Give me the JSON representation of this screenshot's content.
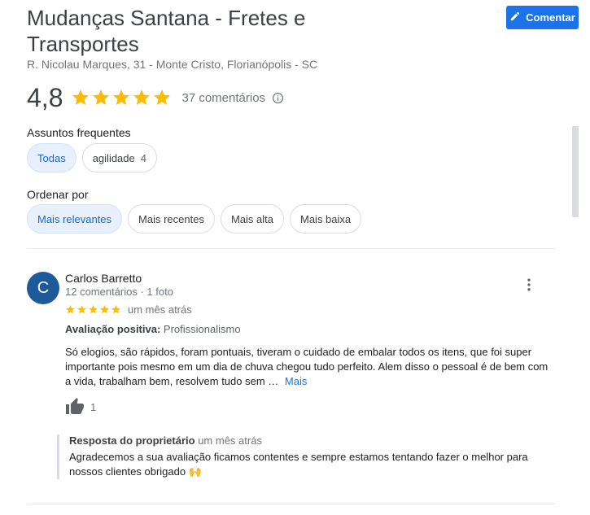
{
  "place": {
    "title": "Mudanças Santana - Fretes e Transportes",
    "address": "R. Nicolau Marques, 31 - Monte Cristo, Florianópolis - SC"
  },
  "header": {
    "comment_button_label": "Comentar"
  },
  "rating": {
    "value": "4,8",
    "stars": 5,
    "review_count_label": "37 comentários"
  },
  "topics": {
    "label": "Assuntos frequentes",
    "chips": [
      {
        "label": "Todas",
        "count": "",
        "active": true
      },
      {
        "label": "agilidade",
        "count": "4",
        "active": false
      }
    ]
  },
  "sort": {
    "label": "Ordenar por",
    "chips": [
      {
        "label": "Mais relevantes",
        "active": true
      },
      {
        "label": "Mais recentes",
        "active": false
      },
      {
        "label": "Mais alta",
        "active": false
      },
      {
        "label": "Mais baixa",
        "active": false
      }
    ]
  },
  "review": {
    "avatar_letter": "C",
    "reviewer_name": "Carlos Barretto",
    "reviewer_meta": "12 comentários · 1 foto",
    "stars": 5,
    "time": "um mês atrás",
    "evaluation_label": "Avaliação positiva:",
    "evaluation_value": "Profissionalismo",
    "text": "Só elogios, são rápidos, foram pontuais, tiveram o cuidado de embalar todos os itens, que foi super importante pois mesmo em um dia de chuva chegou tudo perfeito. Alem disso o pessoal é de bem com a vida, trabalham bem, resolvem tudo sem …",
    "more_label": "Mais",
    "likes": "1",
    "owner_reply": {
      "label": "Resposta do proprietário",
      "time": "um mês atrás",
      "text": "Agradecemos a sua avaliação ficamos contentes e sempre estamos tentando fazer o melhor para nossos clientes obrigado 🙌"
    }
  },
  "colors": {
    "accent": "#1a73e8",
    "star": "#fbbc04",
    "avatar": "#1d5a9c"
  },
  "icons": [
    "edit-icon",
    "star-icon",
    "info-icon",
    "more-vert-icon",
    "thumb-up-icon"
  ]
}
